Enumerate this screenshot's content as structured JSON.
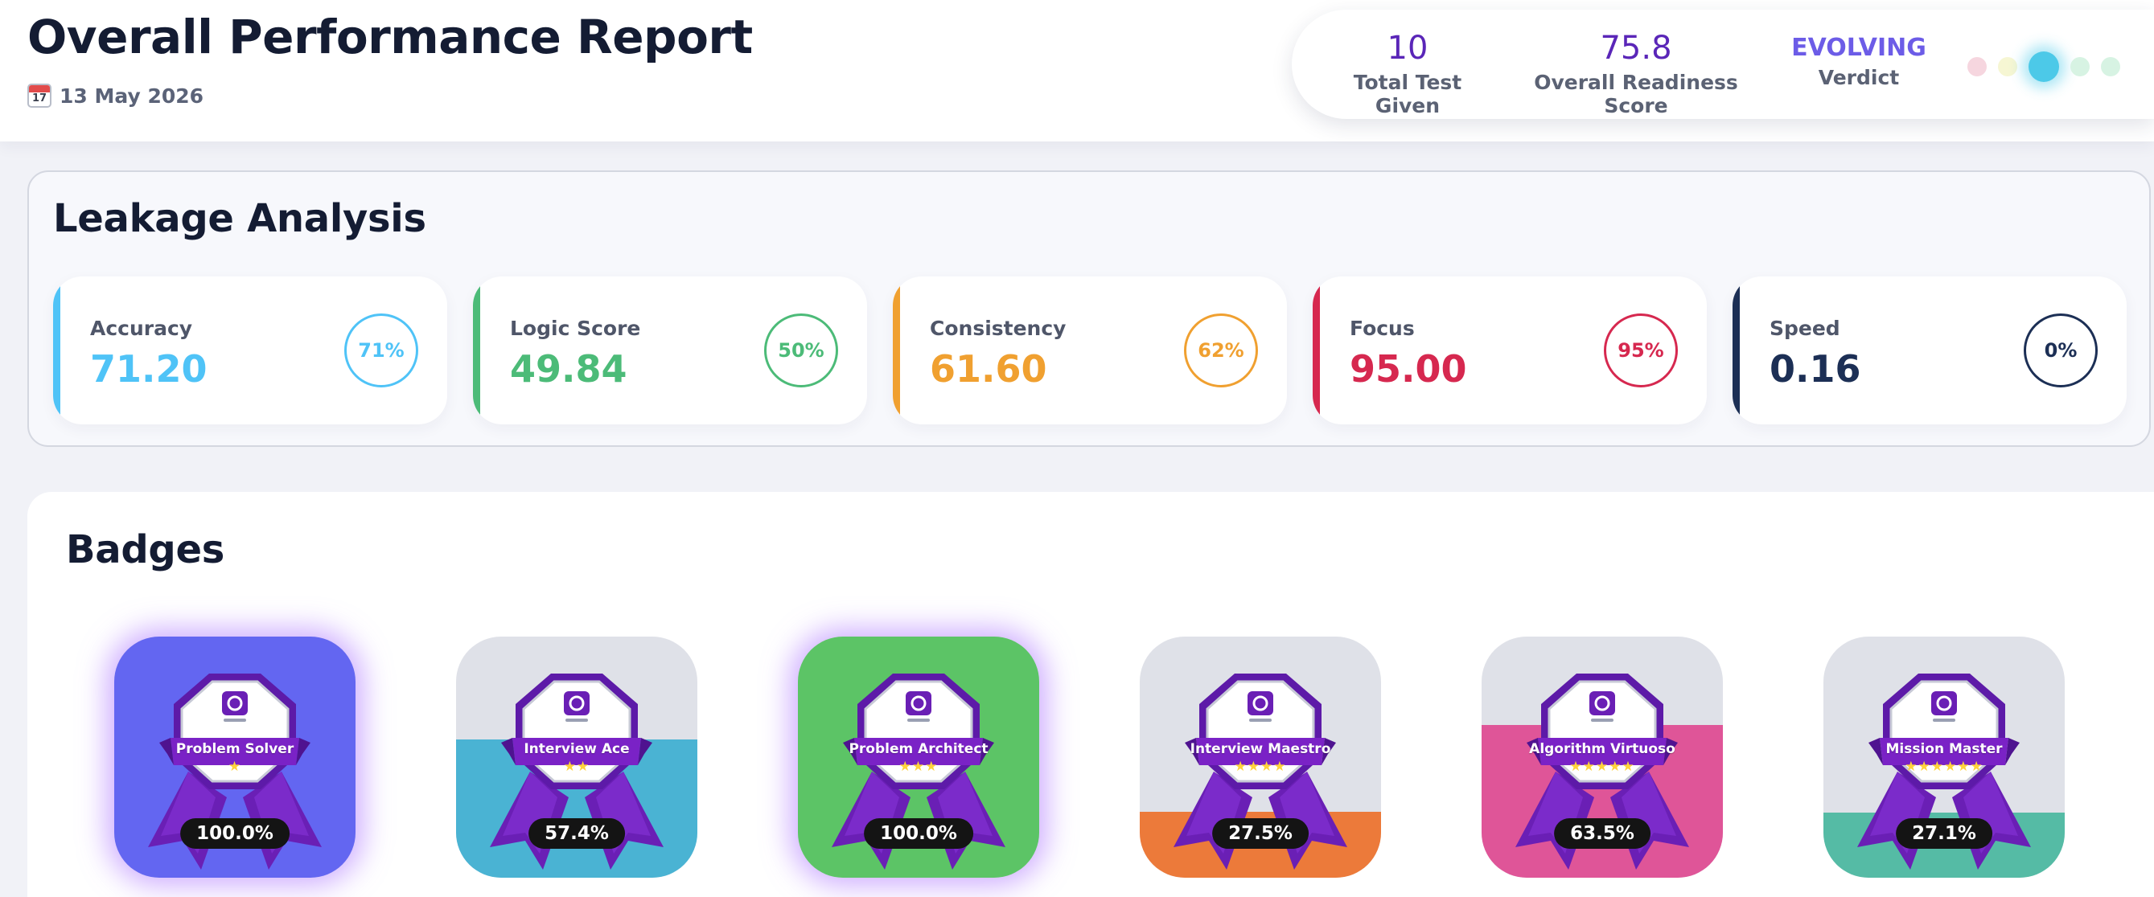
{
  "header": {
    "title": "Overall Performance Report",
    "date": "13 May 2026",
    "calendar_icon_day": "17"
  },
  "stats": {
    "total_tests": {
      "value": "10",
      "label": "Total Test Given"
    },
    "readiness": {
      "value": "75.8",
      "label": "Overall Readiness Score"
    },
    "verdict": {
      "value": "EVOLVING",
      "label": "Verdict"
    },
    "indicator_dots": {
      "count": 5,
      "active_index": 2,
      "colors": [
        "#f6d6df",
        "#f6f6d3",
        "#4cc9e8",
        "#d7f3e3",
        "#d7f3e3"
      ]
    }
  },
  "leakage": {
    "title": "Leakage Analysis",
    "metrics": [
      {
        "label": "Accuracy",
        "value": "71.20",
        "percent": "71%",
        "color": "#4fc3f7"
      },
      {
        "label": "Logic Score",
        "value": "49.84",
        "percent": "50%",
        "color": "#4cbb78"
      },
      {
        "label": "Consistency",
        "value": "61.60",
        "percent": "62%",
        "color": "#f0a030"
      },
      {
        "label": "Focus",
        "value": "95.00",
        "percent": "95%",
        "color": "#d6284f"
      },
      {
        "label": "Speed",
        "value": "0.16",
        "percent": "0%",
        "color": "#1c2f55"
      }
    ]
  },
  "badges": {
    "title": "Badges",
    "items": [
      {
        "name": "Problem Solver",
        "stars": "★",
        "percent": "100.0%",
        "progress": 1.0,
        "fill_color": "#6366f1",
        "glow": true
      },
      {
        "name": "Interview Ace",
        "stars": "★★",
        "percent": "57.4%",
        "progress": 0.574,
        "fill_color": "#4ab3d3",
        "glow": false
      },
      {
        "name": "Problem Architect",
        "stars": "★★★",
        "percent": "100.0%",
        "progress": 1.0,
        "fill_color": "#5cc466",
        "glow": true
      },
      {
        "name": "Interview Maestro",
        "stars": "★★★★",
        "percent": "27.5%",
        "progress": 0.275,
        "fill_color": "#ec7a3a",
        "glow": false
      },
      {
        "name": "Algorithm Virtuoso",
        "stars": "★★★★★",
        "percent": "63.5%",
        "progress": 0.635,
        "fill_color": "#df5598",
        "glow": false
      },
      {
        "name": "Mission Master",
        "stars": "★★★★★★",
        "percent": "27.1%",
        "progress": 0.271,
        "fill_color": "#55bba5",
        "glow": false
      }
    ]
  }
}
